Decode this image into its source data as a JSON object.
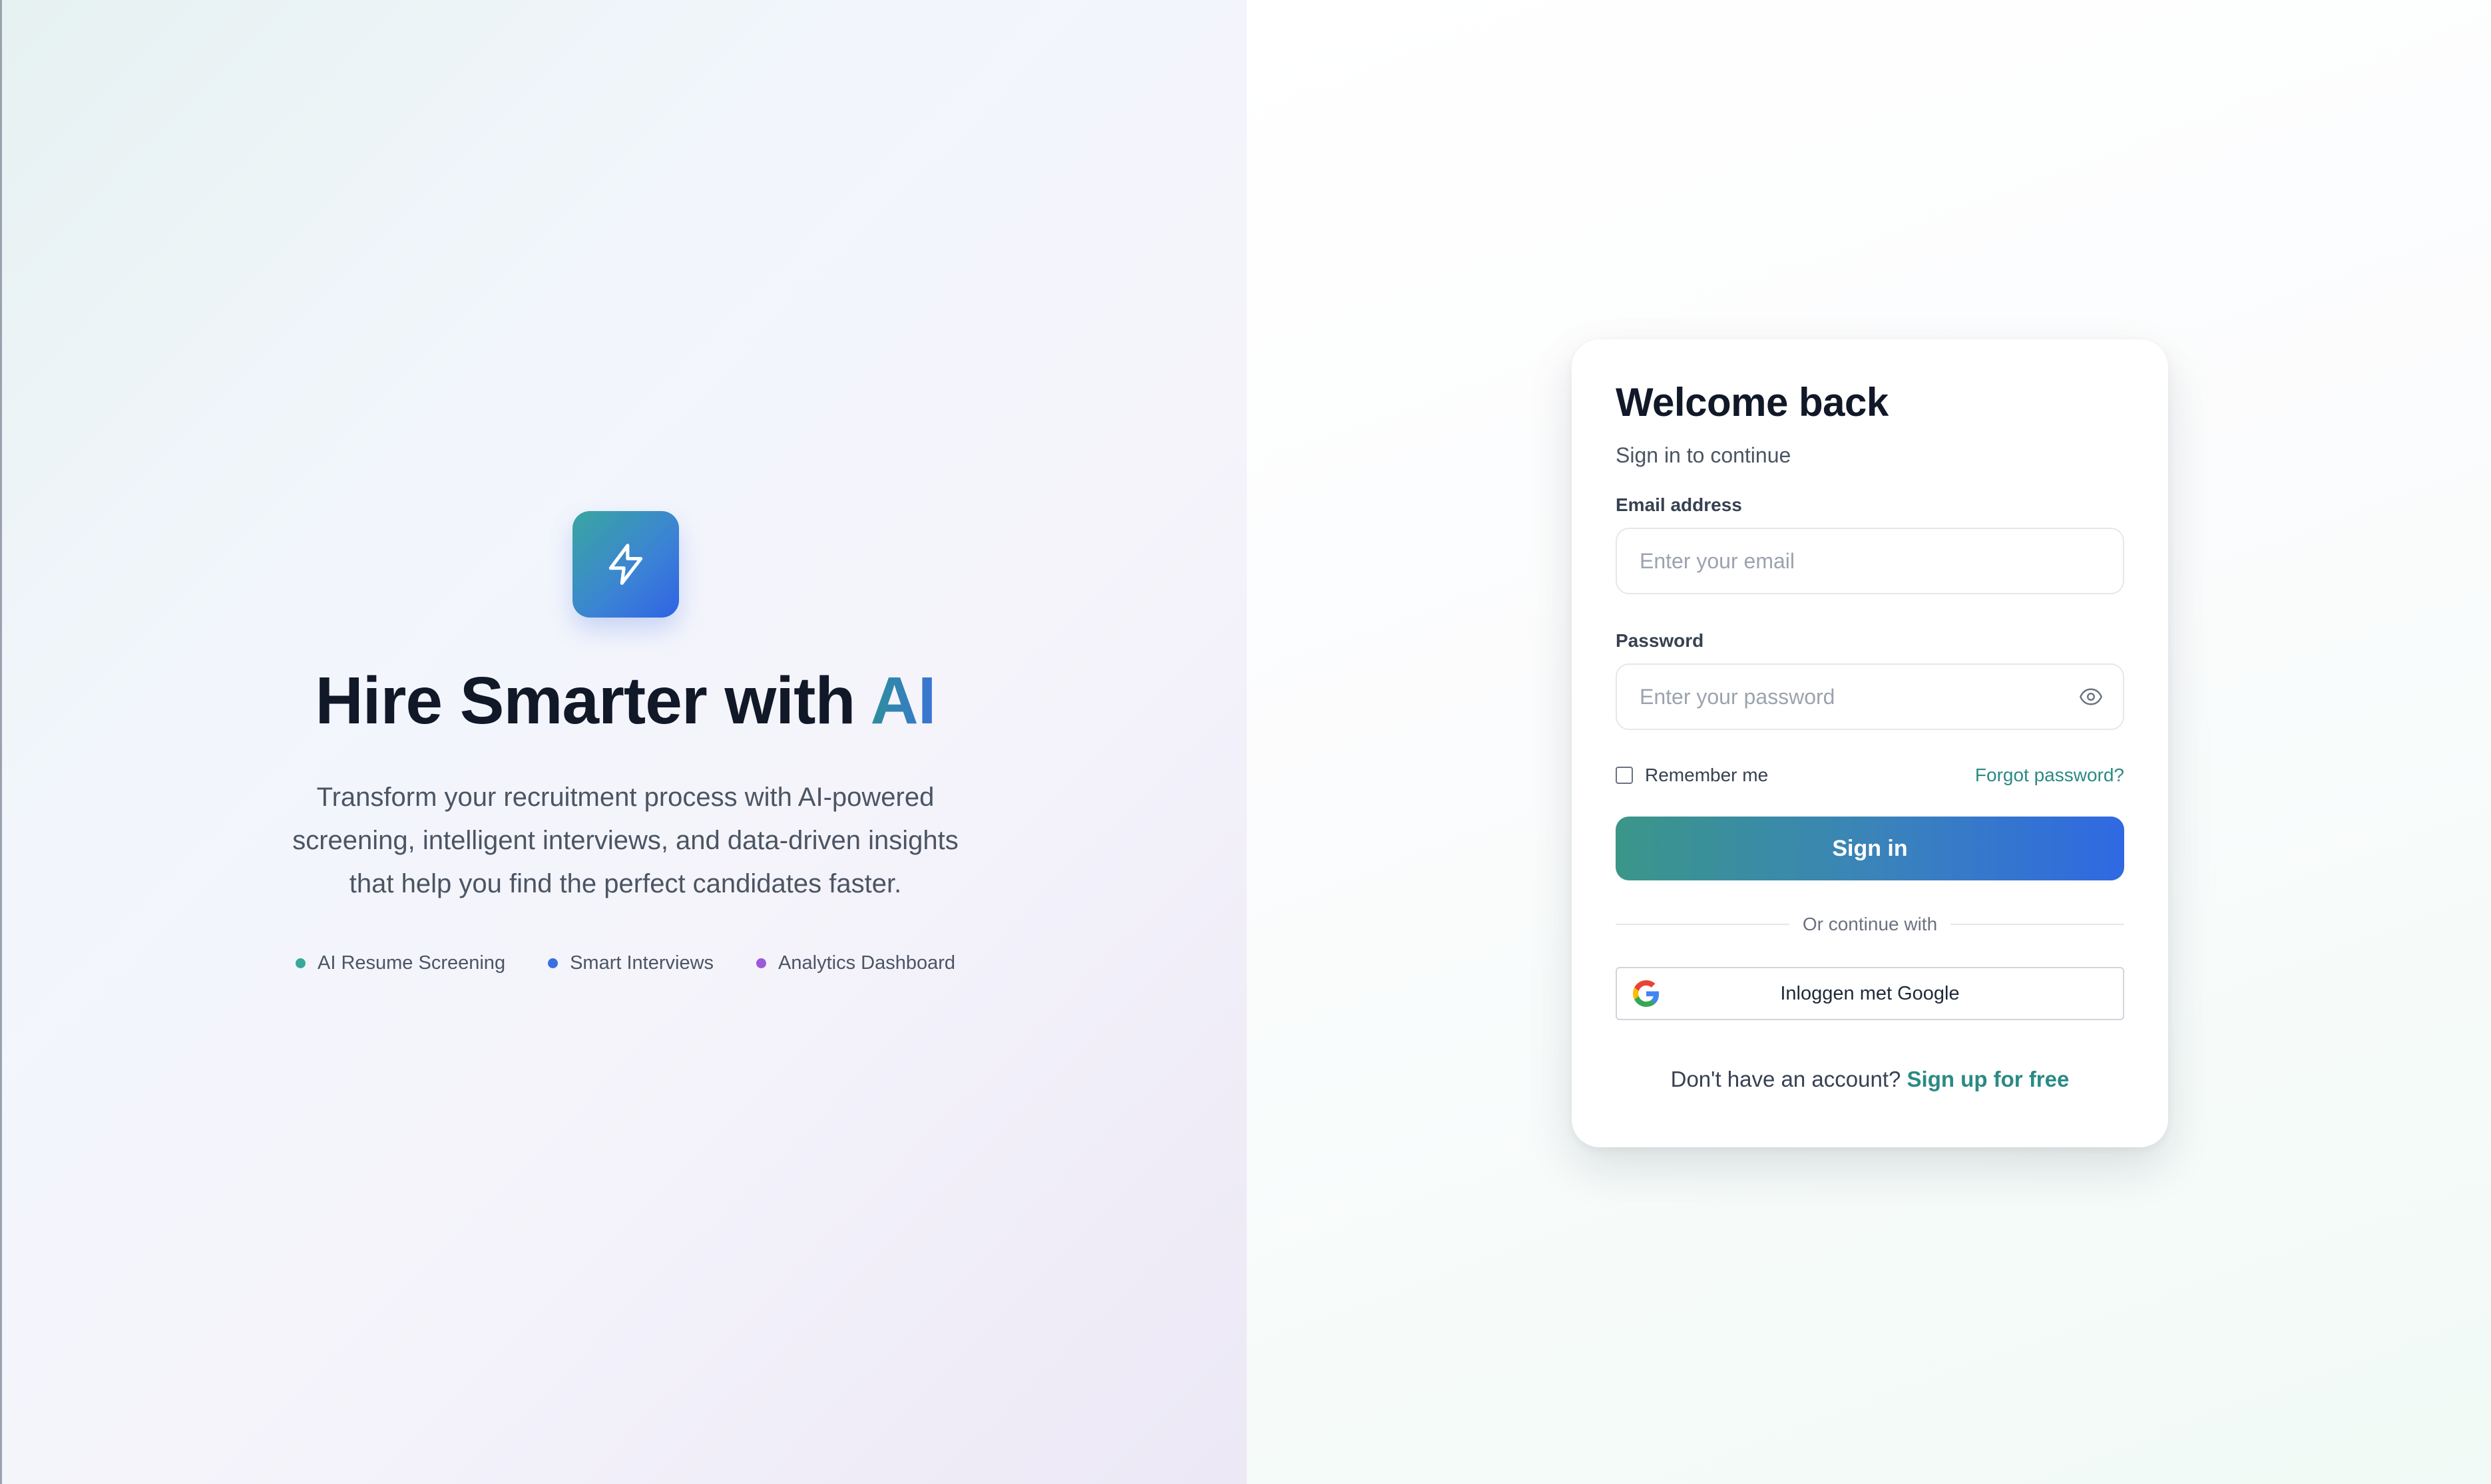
{
  "hero": {
    "logo_icon": "lightning-bolt-icon",
    "title_main": "Hire Smarter with ",
    "title_accent": "AI",
    "description": "Transform your recruitment process with AI-powered screening, intelligent interviews, and data-driven insights that help you find the perfect candidates faster.",
    "features": [
      {
        "label": "AI Resume Screening",
        "color": "#3aa89a"
      },
      {
        "label": "Smart Interviews",
        "color": "#3b6fe0"
      },
      {
        "label": "Analytics Dashboard",
        "color": "#9b5ad8"
      }
    ]
  },
  "login": {
    "title": "Welcome back",
    "subtitle": "Sign in to continue",
    "email_label": "Email address",
    "email_placeholder": "Enter your email",
    "password_label": "Password",
    "password_placeholder": "Enter your password",
    "password_toggle_icon": "eye-icon",
    "remember_label": "Remember me",
    "forgot_label": "Forgot password?",
    "signin_label": "Sign in",
    "divider_label": "Or continue with",
    "google_label": "Inloggen met Google",
    "signup_prompt": "Don't have an account?",
    "signup_link": "Sign up for free"
  },
  "colors": {
    "brand_teal": "#2a8a84",
    "brand_blue": "#2f69e2",
    "text_dark": "#111827"
  }
}
